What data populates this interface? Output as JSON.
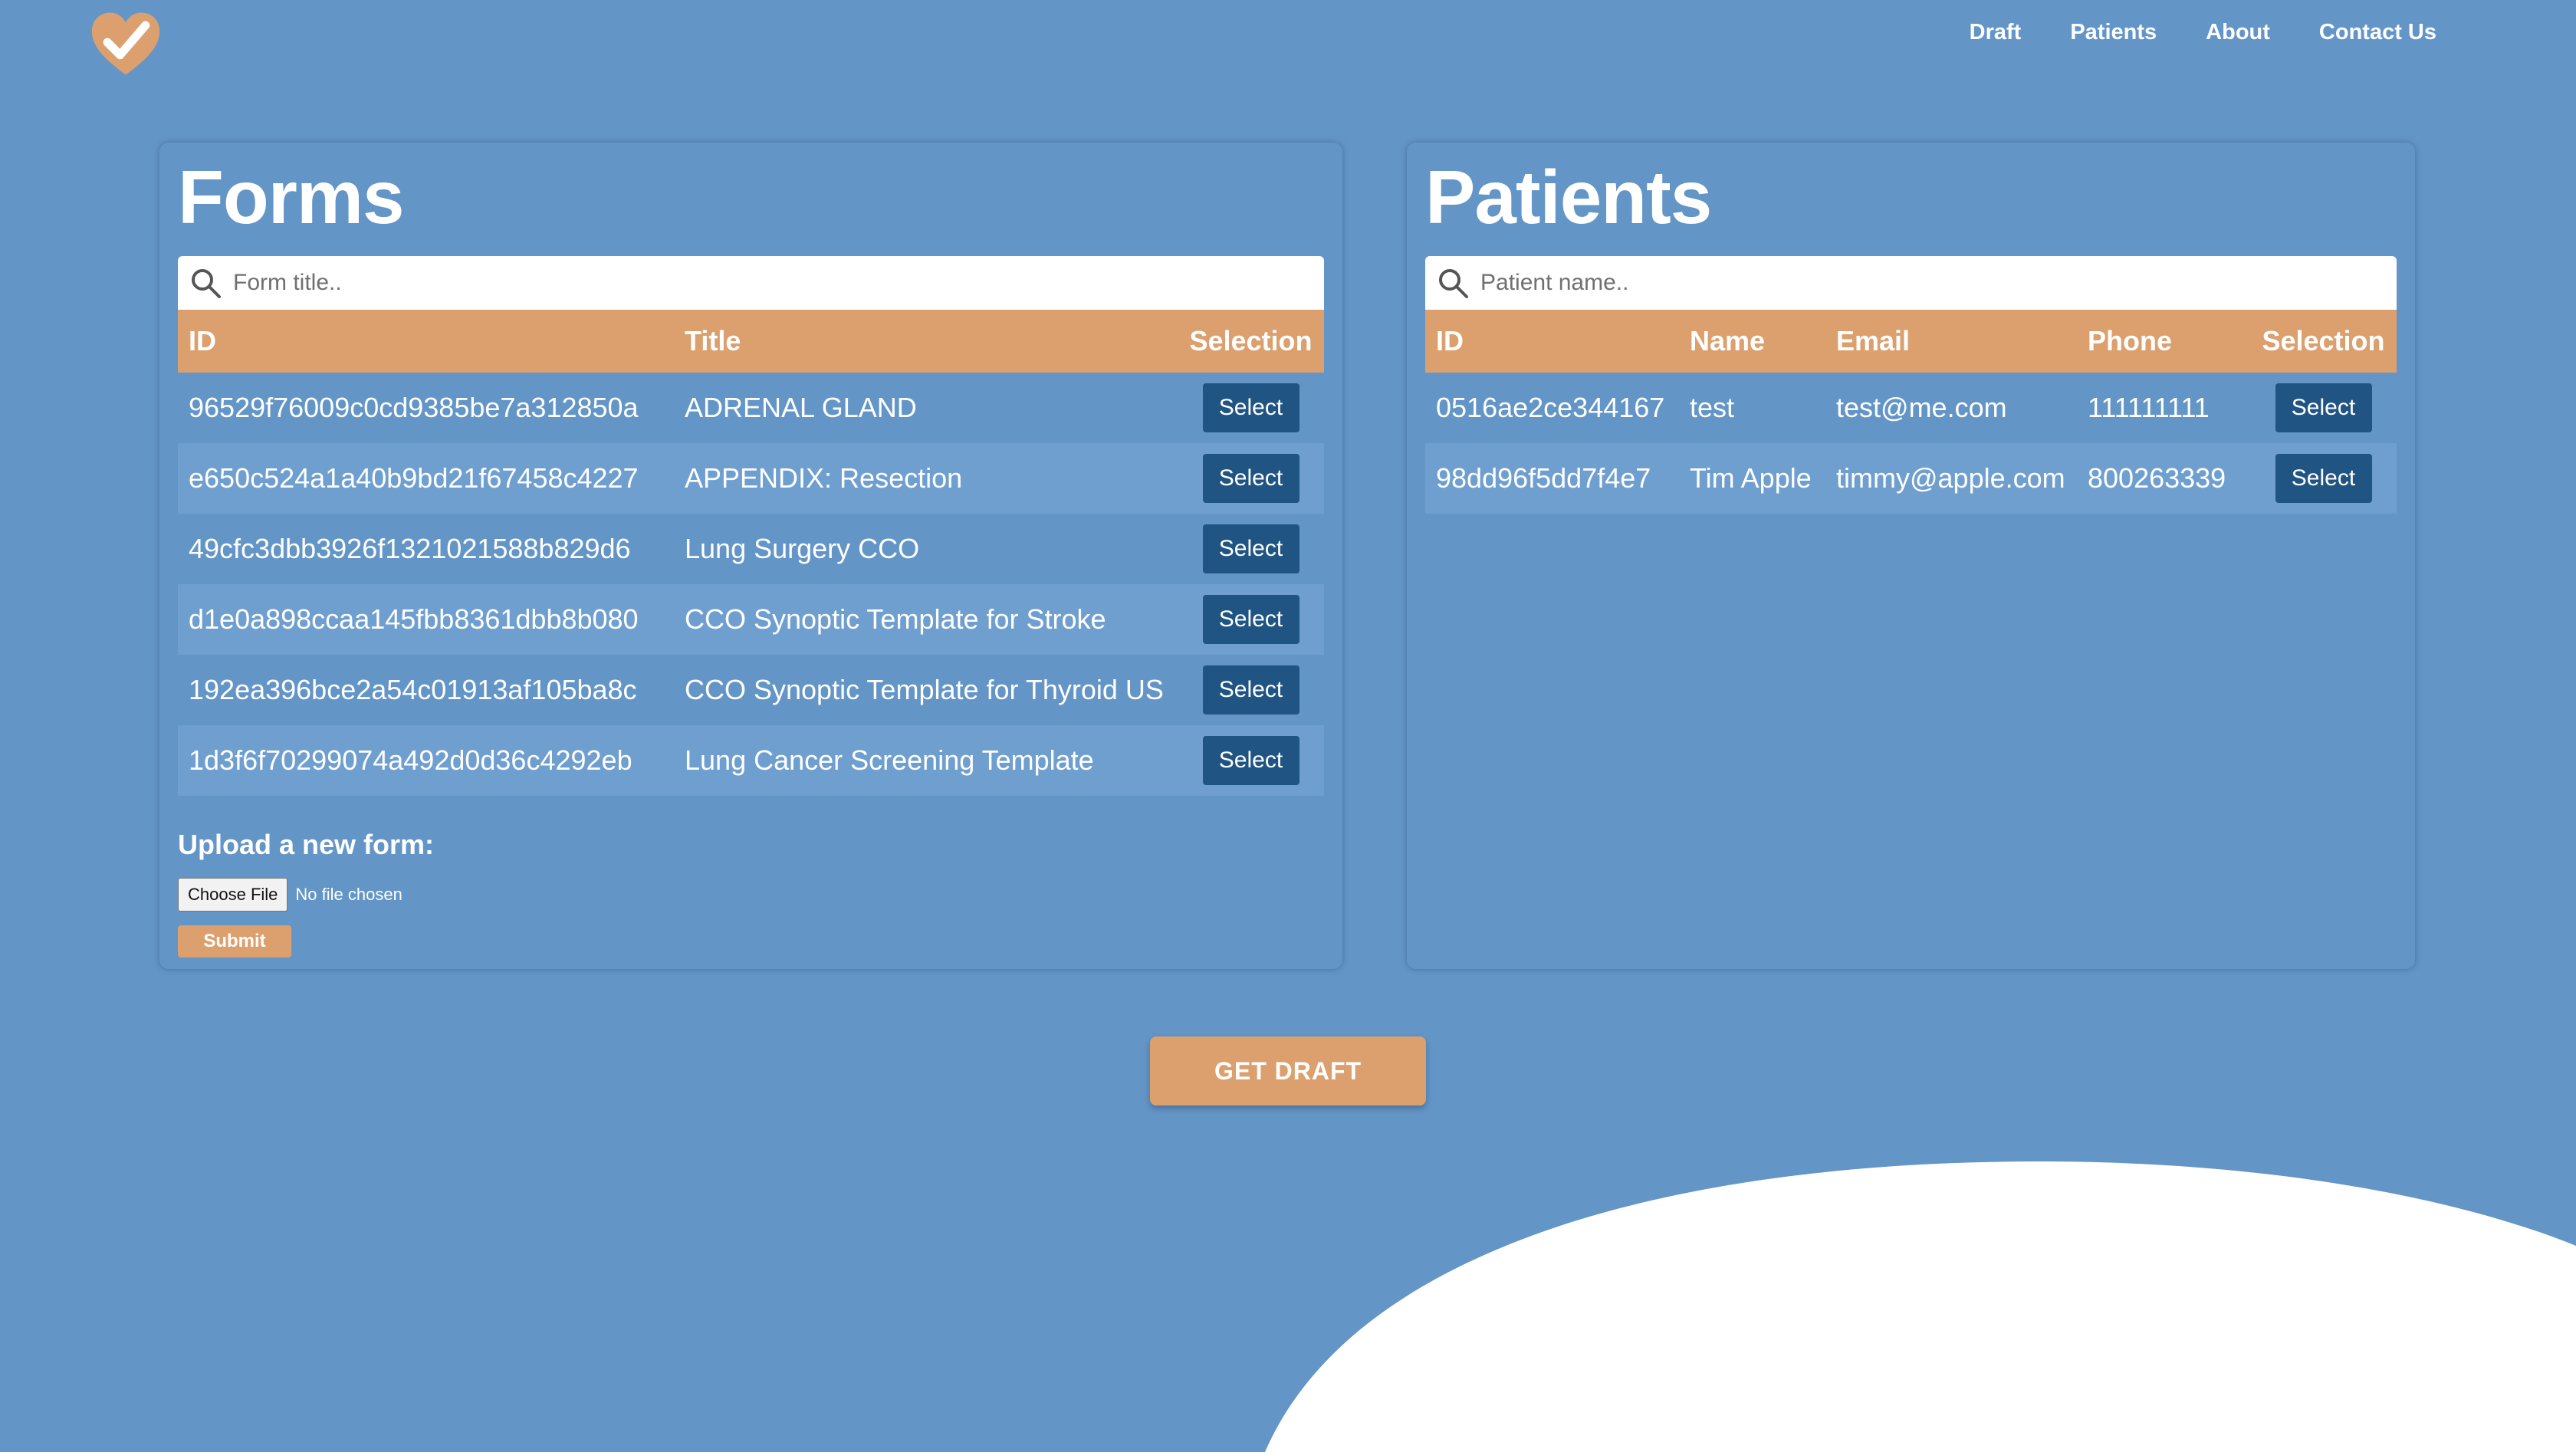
{
  "nav": {
    "items": [
      "Draft",
      "Patients",
      "About",
      "Contact Us"
    ]
  },
  "colors": {
    "background": "#6395c6",
    "accent": "#dca06e",
    "button": "#1f5483",
    "row_alt": "#6f9fcf"
  },
  "icons": {
    "logo": "heart-check-icon",
    "search": "search-icon"
  },
  "forms": {
    "title": "Forms",
    "search_placeholder": "Form title..",
    "columns": [
      "ID",
      "Title",
      "Selection"
    ],
    "rows": [
      {
        "id": "96529f76009c0cd9385be7a312850a",
        "title": "ADRENAL GLAND",
        "action": "Select"
      },
      {
        "id": "e650c524a1a40b9bd21f67458c4227",
        "title": "APPENDIX: Resection",
        "action": "Select"
      },
      {
        "id": "49cfc3dbb3926f1321021588b829d6",
        "title": "Lung Surgery CCO",
        "action": "Select"
      },
      {
        "id": "d1e0a898ccaa145fbb8361dbb8b080",
        "title": "CCO Synoptic Template for Stroke",
        "action": "Select"
      },
      {
        "id": "192ea396bce2a54c01913af105ba8c",
        "title": "CCO Synoptic Template for Thyroid US",
        "action": "Select"
      },
      {
        "id": "1d3f6f70299074a492d0d36c4292eb",
        "title": "Lung Cancer Screening Template",
        "action": "Select"
      }
    ],
    "upload": {
      "heading": "Upload a new form:",
      "choose_label": "Choose File",
      "file_status": "No file chosen",
      "submit_label": "Submit"
    }
  },
  "patients": {
    "title": "Patients",
    "search_placeholder": "Patient name..",
    "columns": [
      "ID",
      "Name",
      "Email",
      "Phone",
      "Selection"
    ],
    "rows": [
      {
        "id": "0516ae2ce344167",
        "name": "test",
        "email": "test@me.com",
        "phone": "111111111",
        "action": "Select"
      },
      {
        "id": "98dd96f5dd7f4e7",
        "name": "Tim Apple",
        "email": "timmy@apple.com",
        "phone": "800263339",
        "action": "Select"
      }
    ]
  },
  "get_draft_label": "GET DRAFT"
}
